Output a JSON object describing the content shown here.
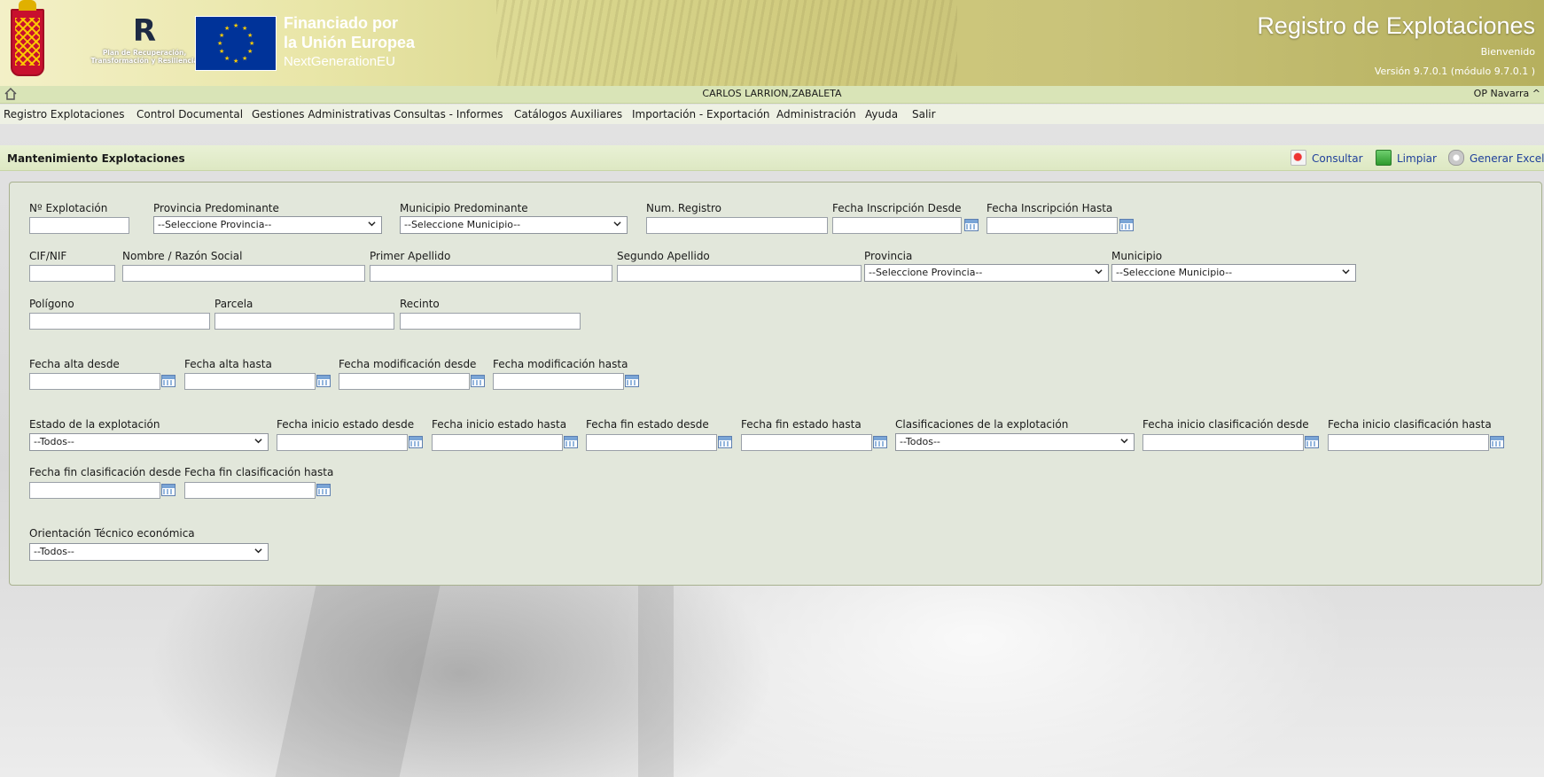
{
  "header": {
    "recovery_logo_mark": "R",
    "recovery_logo_text": "Plan de Recuperación, Transformación y Resiliencia",
    "eu_line1": "Financiado por",
    "eu_line2": "la Unión Europea",
    "eu_line3": "NextGenerationEU",
    "app_title": "Registro de Explotaciones",
    "welcome": "Bienvenido",
    "version": "Versión 9.7.0.1 (módulo 9.7.0.1 )"
  },
  "userbar": {
    "user": "CARLOS LARRION,ZABALETA",
    "org": "OP Navarra ^"
  },
  "menu": [
    "Registro Explotaciones",
    "Control Documental",
    "Gestiones Administrativas",
    "Consultas - Informes",
    "Catálogos Auxiliares",
    "Importación - Exportación",
    "Administración",
    "Ayuda",
    "Salir"
  ],
  "titlebar": {
    "title": "Mantenimiento Explotaciones",
    "consultar": "Consultar",
    "limpiar": "Limpiar",
    "generar_excel": "Generar Excel"
  },
  "form": {
    "num_explotacion": "Nº Explotación",
    "provincia_predominante": "Provincia Predominante",
    "provincia_placeholder": "--Seleccione Provincia--",
    "municipio_predominante": "Municipio Predominante",
    "municipio_placeholder": "--Seleccione Municipio--",
    "num_registro": "Num. Registro",
    "fecha_inscripcion_desde": "Fecha Inscripción Desde",
    "fecha_inscripcion_hasta": "Fecha Inscripción Hasta",
    "cif_nif": "CIF/NIF",
    "nombre_razon": "Nombre / Razón Social",
    "primer_apellido": "Primer Apellido",
    "segundo_apellido": "Segundo Apellido",
    "provincia": "Provincia",
    "municipio": "Municipio",
    "poligono": "Polígono",
    "parcela": "Parcela",
    "recinto": "Recinto",
    "fecha_alta_desde": "Fecha alta desde",
    "fecha_alta_hasta": "Fecha alta hasta",
    "fecha_mod_desde": "Fecha modificación desde",
    "fecha_mod_hasta": "Fecha modificación hasta",
    "estado_explotacion": "Estado de la explotación",
    "todos": "--Todos--",
    "fecha_inicio_estado_desde": "Fecha inicio estado desde",
    "fecha_inicio_estado_hasta": "Fecha inicio estado hasta",
    "fecha_fin_estado_desde": "Fecha fin estado desde",
    "fecha_fin_estado_hasta": "Fecha fin estado hasta",
    "clasificaciones": "Clasificaciones de la explotación",
    "fecha_inicio_clas_desde": "Fecha inicio clasificación desde",
    "fecha_inicio_clas_hasta": "Fecha inicio clasificación hasta",
    "fecha_fin_clas_desde": "Fecha fin clasificación desde",
    "fecha_fin_clas_hasta": "Fecha fin clasificación hasta",
    "orientacion": "Orientación Técnico económica"
  }
}
